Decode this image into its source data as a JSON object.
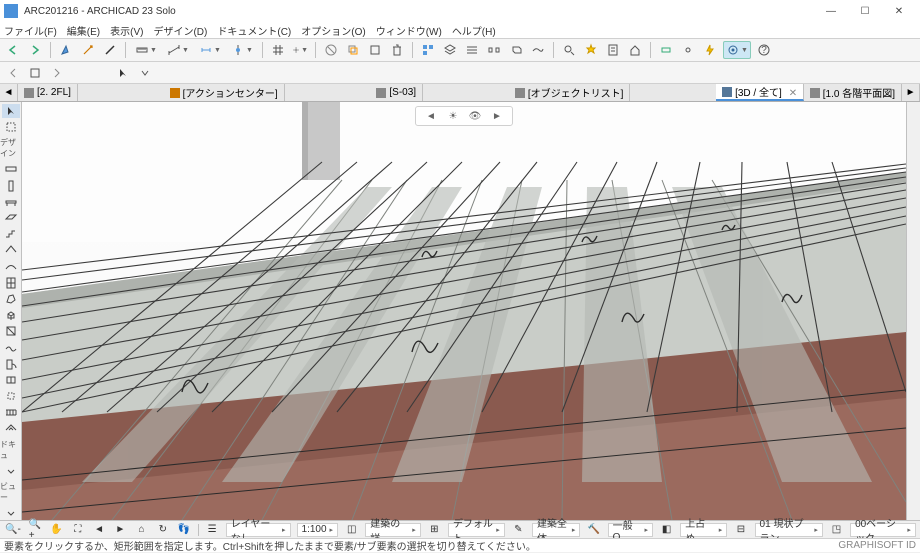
{
  "window": {
    "title": "ARC201216 - ARCHICAD 23 Solo",
    "min": "—",
    "max": "☐",
    "close": "✕"
  },
  "menu": {
    "file": "ファイル(F)",
    "edit": "編集(E)",
    "view": "表示(V)",
    "design": "デザイン(D)",
    "document": "ドキュメント(C)",
    "options": "オプション(O)",
    "window": "ウィンドウ(W)",
    "help": "ヘルプ(H)"
  },
  "tabs": {
    "t1": "[2. 2FL]",
    "t2": "[アクションセンター]",
    "t3": "[S-03]",
    "t4": "[オブジェクトリスト]",
    "t5": "[3D / 全て]",
    "t6": "[1.0 各階平面図]"
  },
  "left": {
    "g1": "デザイン",
    "g2": "ドキュ",
    "g3": "ビュー"
  },
  "status": {
    "layerset": "レイヤーなし",
    "scale": "1:100",
    "dim": "建築の詳...",
    "model": "デフォルト",
    "pens": "建築全体",
    "reno": "一般O...",
    "partial": "上占め...",
    "plan": "01 現状プラン",
    "mvo": "00ベーシック"
  },
  "hint": {
    "text": "要素をクリックするか、矩形範囲を指定します。Ctrl+Shiftを押したままで要素/サブ要素の選択を切り替えてください。",
    "brand": "GRAPHISOFT ID"
  }
}
